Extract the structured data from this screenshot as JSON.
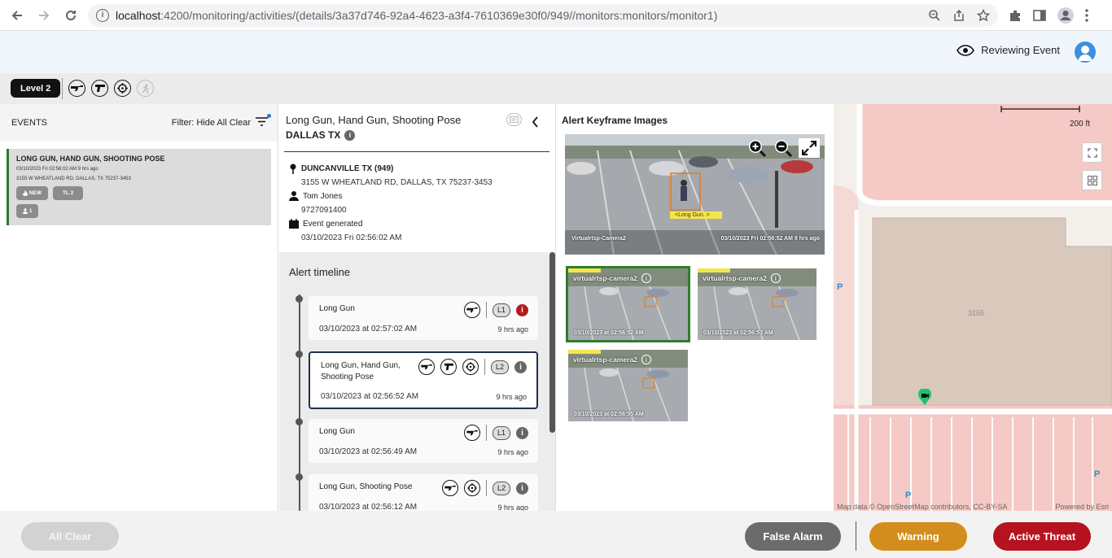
{
  "browser": {
    "url_host": "localhost",
    "url_rest": ":4200/monitoring/activities/(details/3a37d746-92a4-4623-a3f4-7610369e30f0/949//monitors:monitors/monitor1)"
  },
  "header": {
    "reviewing_label": "Reviewing Event"
  },
  "toolbar": {
    "level_label": "Level 2"
  },
  "events": {
    "title": "EVENTS",
    "filter_label": "Filter: Hide All Clear",
    "items": [
      {
        "title": "LONG GUN, HAND GUN, SHOOTING POSE",
        "datetime": "03/10/2023 Fri 02:56:02 AM 9 hrs ago",
        "address": "3155 W WHEATLAND RD, DALLAS, TX 75237-3453",
        "chip_new": "NEW",
        "chip_level": "TL 2",
        "chip_count": "1"
      }
    ]
  },
  "details": {
    "title": "Long Gun, Hand Gun, Shooting Pose",
    "location": "DALLAS TX",
    "site": "DUNCANVILLE TX (949)",
    "address": "3155 W WHEATLAND RD, DALLAS, TX 75237-3453",
    "contact_name": "Tom Jones",
    "contact_phone": "9727091400",
    "generated_label": "Event generated",
    "generated_time": "03/10/2023 Fri 02:56:02 AM"
  },
  "timeline": {
    "title": "Alert timeline",
    "items": [
      {
        "name": "Long Gun",
        "time": "03/10/2023 at 02:57:02 AM",
        "ago": "9 hrs ago",
        "level": "L1"
      },
      {
        "name": "Long Gun, Hand Gun, Shooting Pose",
        "time": "03/10/2023 at 02:56:52 AM",
        "ago": "9 hrs ago",
        "level": "L2"
      },
      {
        "name": "Long Gun",
        "time": "03/10/2023 at 02:56:49 AM",
        "ago": "9 hrs ago",
        "level": "L1"
      },
      {
        "name": "Long Gun, Shooting Pose",
        "time": "03/10/2023 at 02:56:12 AM",
        "ago": "9 hrs ago",
        "level": "L2"
      }
    ]
  },
  "keyframes": {
    "title": "Alert Keyframe Images",
    "main": {
      "camera": "Virtualrtsp-Camera2",
      "time": "03/10/2023 Fri 02:56:52 AM 9 hrs ago",
      "detection_label": "<Long Gun. >"
    },
    "thumbs": [
      {
        "camera": "virtualrtsp-camera2",
        "time": "03/10/2023 at 02:56:52 AM"
      },
      {
        "camera": "virtualrtsp-camera2",
        "time": "03/10/2023 at 02:56:53 AM"
      },
      {
        "camera": "virtualrtsp-camera2",
        "time": "03/10/2023 at 02:56:55 AM"
      }
    ]
  },
  "map": {
    "scale": "200 ft",
    "building_label": "3155",
    "attribution": "Map data © OpenStreetMap contributors, CC-BY-SA",
    "powered": "Powered by Esri",
    "parking_label": "P"
  },
  "footer": {
    "all_clear": "All Clear",
    "false_alarm": "False Alarm",
    "warning": "Warning",
    "active_threat": "Active Threat"
  },
  "colors": {
    "active_threat": "#b7121f",
    "warning": "#d38d1c",
    "false_alarm": "#6b6b6b",
    "selected_thumb": "#2f7d2c",
    "map_building": "#d9c8bc"
  }
}
